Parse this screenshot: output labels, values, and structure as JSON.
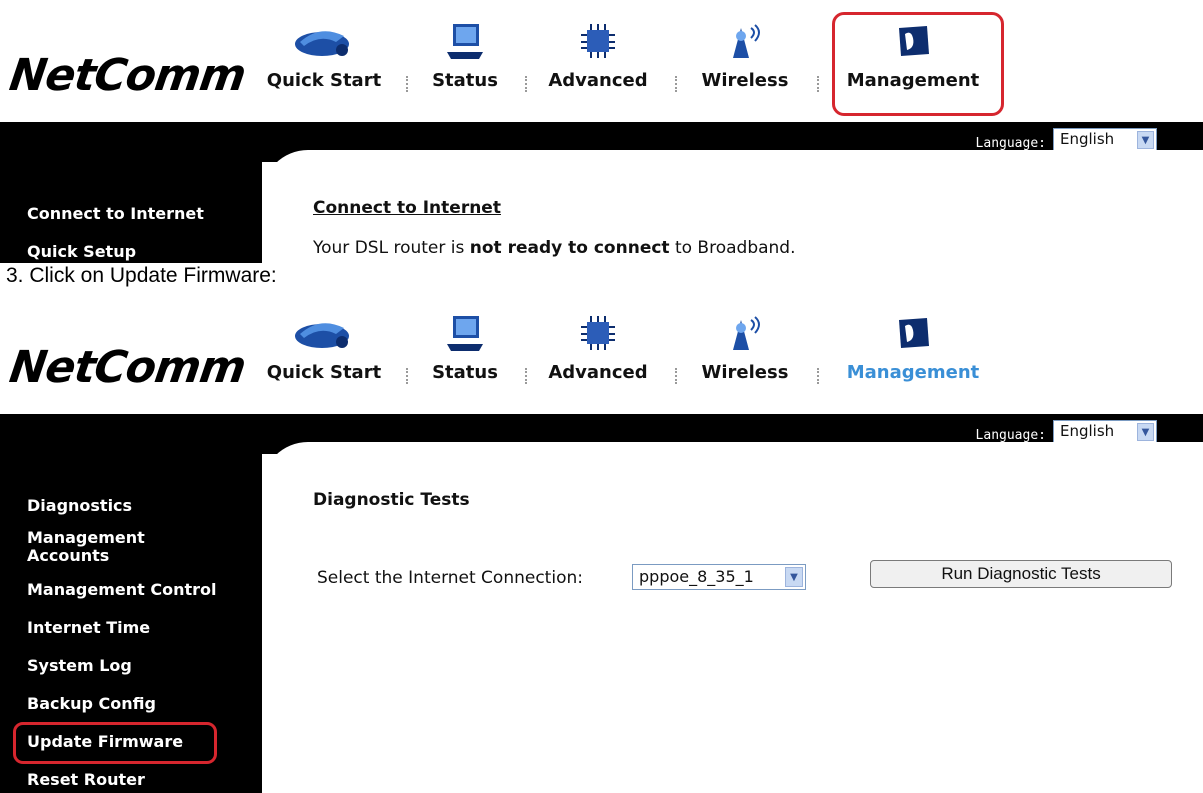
{
  "brand": "NetComm",
  "nav": [
    {
      "label": "Quick Start",
      "icon": "quick-start-icon"
    },
    {
      "label": "Status",
      "icon": "status-laptop-icon"
    },
    {
      "label": "Advanced",
      "icon": "advanced-chip-icon"
    },
    {
      "label": "Wireless",
      "icon": "wireless-antenna-icon"
    },
    {
      "label": "Management",
      "icon": "management-icon"
    }
  ],
  "language": {
    "label": "Language:",
    "value": "English"
  },
  "shot1": {
    "sidebar": [
      "Connect to Internet",
      "Quick Setup"
    ],
    "title": "Connect to Internet",
    "status_prefix": "Your DSL router is ",
    "status_bold": "not ready to connect",
    "status_suffix": " to Broadband."
  },
  "step_text": "3.   Click on Update Firmware:",
  "shot2": {
    "sidebar": [
      "Diagnostics",
      "Management",
      "Accounts",
      "Management Control",
      "Internet Time",
      "System Log",
      "Backup Config",
      "Update Firmware",
      "Reset Router"
    ],
    "title": "Diagnostic Tests",
    "select_label": "Select the Internet Connection:",
    "select_value": "pppoe_8_35_1",
    "run_button": "Run Diagnostic Tests"
  },
  "colors": {
    "active_nav": "#3a8fd6",
    "highlight": "#d6262e",
    "band": "#000000"
  }
}
